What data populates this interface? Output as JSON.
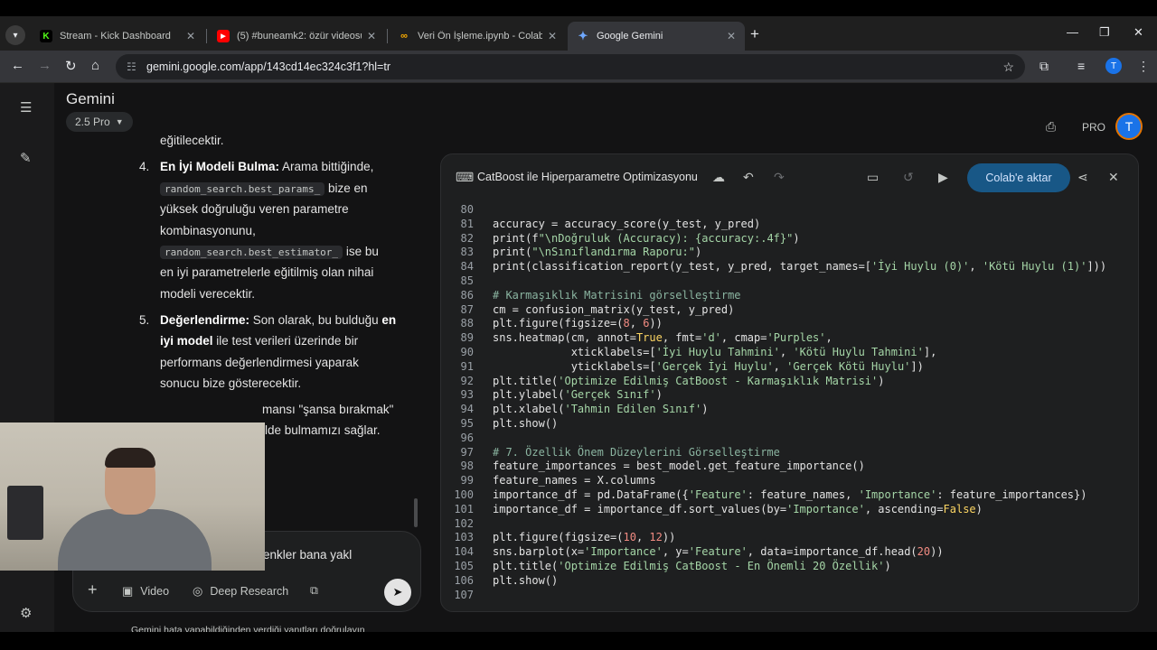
{
  "browser": {
    "tabs": [
      {
        "label": "Stream - Kick Dashboard",
        "icon": "kick-icon",
        "color": "#53fc18"
      },
      {
        "label": "(5) #buneamk2: özür videosu. -",
        "icon": "youtube-icon",
        "color": "#ff0000"
      },
      {
        "label": "Veri Ön İşleme.ipynb - Colab",
        "icon": "colab-icon",
        "color": "#f9ab00"
      },
      {
        "label": "Google Gemini",
        "icon": "gemini-icon",
        "color": "#4285f4"
      }
    ],
    "url": "gemini.google.com/app/143cd14ec324c3f1?hl=tr",
    "profile_initial": "T"
  },
  "gemini": {
    "brand": "Gemini",
    "model": "2.5 Pro",
    "pro_label": "PRO",
    "avatar_initial": "T"
  },
  "chat": {
    "top_line": "eğitilecektir.",
    "item4": {
      "num": "4.",
      "bold": "En İyi Modeli Bulma:",
      "text1": "Arama bittiğinde,",
      "code1": "random_search.best_params_",
      "text2": "bize en",
      "text3": "yüksek doğruluğu veren parametre",
      "text4": "kombinasyonunu,",
      "code2": "random_search.best_estimator_",
      "text5": "ise bu",
      "text6": "en iyi parametrelerle eğitilmiş olan nihai",
      "text7": "modeli verecektir."
    },
    "item5": {
      "num": "5.",
      "bold": "Değerlendirme:",
      "text1": "Son olarak, bu bulduğu",
      "bold2": "en",
      "bold3": "iyi model",
      "text2": "ile test verileri üzerinde bir",
      "text3": "performans değerlendirmesi yaparak",
      "text4": "sonucu bize gösterecektir."
    },
    "partial1": "mansı \"şansa bırakmak\"",
    "partial2": "ilde bulmamızı sağlar."
  },
  "input": {
    "text": "enkler bana yakl",
    "tools": [
      "Video",
      "Deep Research"
    ],
    "disclaimer": "Gemini hata yapabildiğinden verdiği yanıtları doğrulayın"
  },
  "canvas": {
    "title": "CatBoost ile Hiperparametre Optimizasyonu",
    "export_label": "Colab'e aktar"
  },
  "code_lines": [
    {
      "n": "80",
      "t": ""
    },
    {
      "n": "81",
      "t": "accuracy = accuracy_score(y_test, y_pred)"
    },
    {
      "n": "82",
      "t": "print(f\"\\nDoğruluk (Accuracy): {accuracy:.4f}\")"
    },
    {
      "n": "83",
      "t": "print(\"\\nSınıflandırma Raporu:\")"
    },
    {
      "n": "84",
      "t": "print(classification_report(y_test, y_pred, target_names=['İyi Huylu (0)', 'Kötü Huylu (1)']))"
    },
    {
      "n": "85",
      "t": ""
    },
    {
      "n": "86",
      "t": "# Karmaşıklık Matrisini görselleştirme"
    },
    {
      "n": "87",
      "t": "cm = confusion_matrix(y_test, y_pred)"
    },
    {
      "n": "88",
      "t": "plt.figure(figsize=(8, 6))"
    },
    {
      "n": "89",
      "t": "sns.heatmap(cm, annot=True, fmt='d', cmap='Purples',"
    },
    {
      "n": "90",
      "t": "            xticklabels=['İyi Huylu Tahmini', 'Kötü Huylu Tahmini'],"
    },
    {
      "n": "91",
      "t": "            yticklabels=['Gerçek İyi Huylu', 'Gerçek Kötü Huylu'])"
    },
    {
      "n": "92",
      "t": "plt.title('Optimize Edilmiş CatBoost - Karmaşıklık Matrisi')"
    },
    {
      "n": "93",
      "t": "plt.ylabel('Gerçek Sınıf')"
    },
    {
      "n": "94",
      "t": "plt.xlabel('Tahmin Edilen Sınıf')"
    },
    {
      "n": "95",
      "t": "plt.show()"
    },
    {
      "n": "96",
      "t": ""
    },
    {
      "n": "97",
      "t": "# 7. Özellik Önem Düzeylerini Görselleştirme"
    },
    {
      "n": "98",
      "t": "feature_importances = best_model.get_feature_importance()"
    },
    {
      "n": "99",
      "t": "feature_names = X.columns"
    },
    {
      "n": "100",
      "t": "importance_df = pd.DataFrame({'Feature': feature_names, 'Importance': feature_importances})"
    },
    {
      "n": "101",
      "t": "importance_df = importance_df.sort_values(by='Importance', ascending=False)"
    },
    {
      "n": "102",
      "t": ""
    },
    {
      "n": "103",
      "t": "plt.figure(figsize=(10, 12))"
    },
    {
      "n": "104",
      "t": "sns.barplot(x='Importance', y='Feature', data=importance_df.head(20))"
    },
    {
      "n": "105",
      "t": "plt.title('Optimize Edilmiş CatBoost - En Önemli 20 Özellik')"
    },
    {
      "n": "106",
      "t": "plt.show()"
    },
    {
      "n": "107",
      "t": ""
    }
  ]
}
